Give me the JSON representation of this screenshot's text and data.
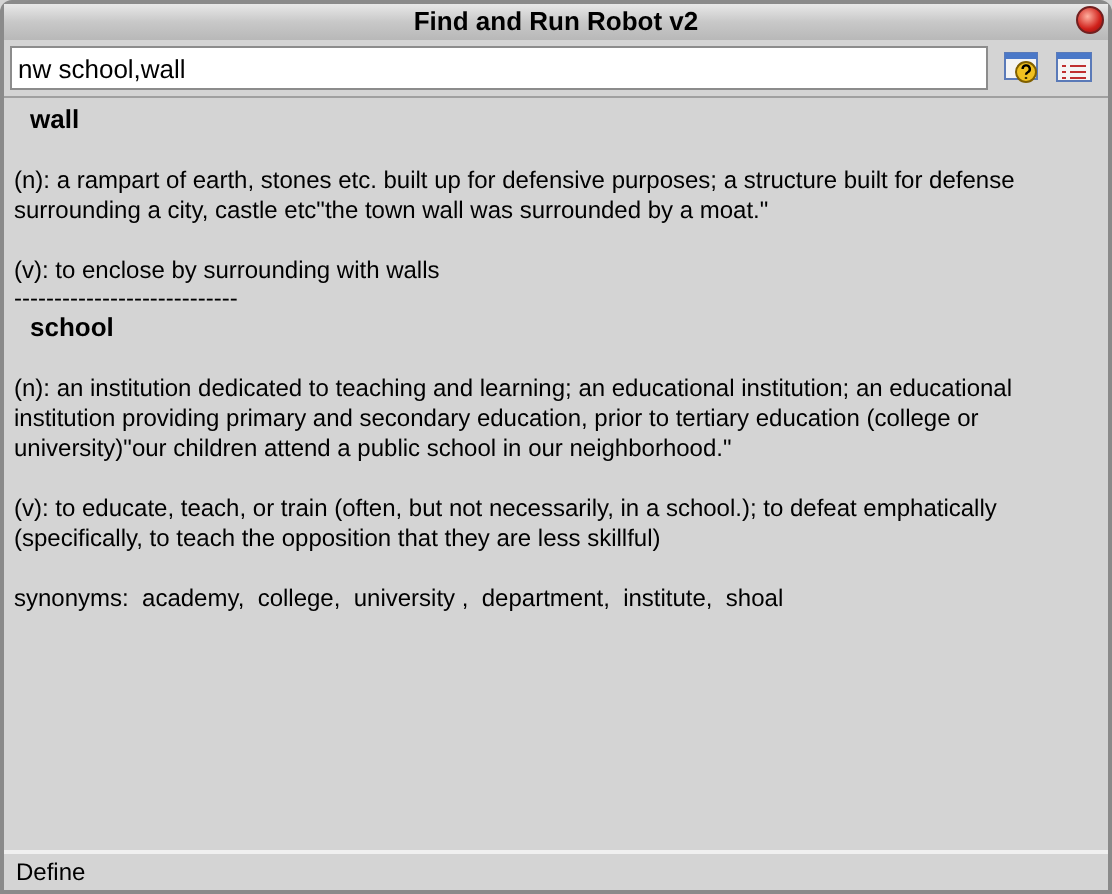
{
  "window": {
    "title": "Find and Run Robot v2"
  },
  "search": {
    "value": "nw school,wall"
  },
  "entries": [
    {
      "word": "wall",
      "senses": [
        "(n): a rampart of earth, stones etc. built up for defensive purposes; a structure built for defense surrounding a city, castle etc\"the town wall was surrounded by a moat.\"",
        "(v): to enclose by surrounding with walls"
      ]
    },
    {
      "separator": "----------------------------",
      "word": "school",
      "senses": [
        "(n): an institution dedicated to teaching and learning; an educational institution; an educational institution providing primary and secondary education, prior to tertiary education (college or university)\"our children attend a public school in our neighborhood.\"",
        "(v): to educate, teach, or train (often, but not necessarily, in a school.); to defeat emphatically (specifically, to teach the opposition that they are less skillful)"
      ],
      "synonyms": "synonyms:  academy,  college,  university ,  department,  institute,  shoal"
    }
  ],
  "status_bar": "Define"
}
